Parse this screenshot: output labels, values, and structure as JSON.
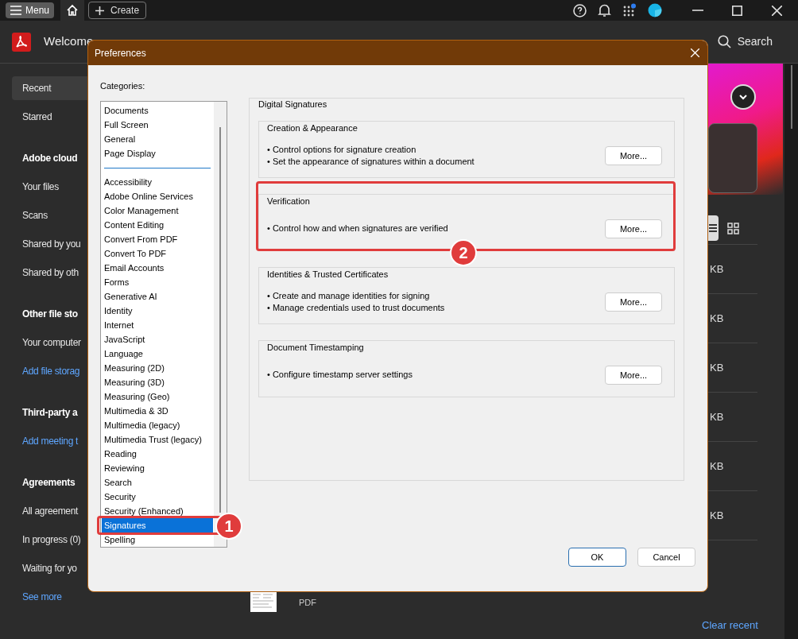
{
  "top_bar": {
    "menu_label": "Menu",
    "create_label": "Create"
  },
  "header": {
    "title": "Welcome",
    "search_label": "Search"
  },
  "sidebar": [
    {
      "kind": "item",
      "label": "Recent",
      "selected": true
    },
    {
      "kind": "item",
      "label": "Starred",
      "selected": false
    },
    {
      "kind": "heading",
      "label": "Adobe cloud"
    },
    {
      "kind": "item",
      "label": "Your files",
      "selected": false
    },
    {
      "kind": "item",
      "label": "Scans",
      "selected": false
    },
    {
      "kind": "item",
      "label": "Shared by you",
      "selected": false
    },
    {
      "kind": "item",
      "label": "Shared by oth",
      "selected": false
    },
    {
      "kind": "heading",
      "label": "Other file sto"
    },
    {
      "kind": "item",
      "label": "Your computer",
      "selected": false
    },
    {
      "kind": "link",
      "label": "Add file storag"
    },
    {
      "kind": "heading",
      "label": "Third-party a"
    },
    {
      "kind": "link",
      "label": "Add meeting t"
    },
    {
      "kind": "heading",
      "label": "Agreements"
    },
    {
      "kind": "item",
      "label": "All agreement",
      "selected": false
    },
    {
      "kind": "item",
      "label": "In progress (0)",
      "selected": false
    },
    {
      "kind": "item",
      "label": "Waiting for yo",
      "selected": false
    },
    {
      "kind": "link",
      "label": "See more"
    }
  ],
  "files": {
    "sizes": [
      "KB",
      "KB",
      "KB",
      "KB",
      "KB",
      "KB"
    ],
    "last_file_type": "PDF",
    "clear_recent": "Clear recent"
  },
  "dialog": {
    "title": "Preferences",
    "categories_label": "Categories:",
    "category_groups": [
      [
        {
          "label": "Documents",
          "selected": false
        },
        {
          "label": "Full Screen",
          "selected": false
        },
        {
          "label": "General",
          "selected": false
        },
        {
          "label": "Page Display",
          "selected": false
        }
      ],
      [
        {
          "label": "Accessibility",
          "selected": false
        },
        {
          "label": "Adobe Online Services",
          "selected": false
        },
        {
          "label": "Color Management",
          "selected": false
        },
        {
          "label": "Content Editing",
          "selected": false
        },
        {
          "label": "Convert From PDF",
          "selected": false
        },
        {
          "label": "Convert To PDF",
          "selected": false
        },
        {
          "label": "Email Accounts",
          "selected": false
        },
        {
          "label": "Forms",
          "selected": false
        },
        {
          "label": "Generative AI",
          "selected": false
        },
        {
          "label": "Identity",
          "selected": false
        },
        {
          "label": "Internet",
          "selected": false
        },
        {
          "label": "JavaScript",
          "selected": false
        },
        {
          "label": "Language",
          "selected": false
        },
        {
          "label": "Measuring (2D)",
          "selected": false
        },
        {
          "label": "Measuring (3D)",
          "selected": false
        },
        {
          "label": "Measuring (Geo)",
          "selected": false
        },
        {
          "label": "Multimedia & 3D",
          "selected": false
        },
        {
          "label": "Multimedia (legacy)",
          "selected": false
        },
        {
          "label": "Multimedia Trust (legacy)",
          "selected": false
        },
        {
          "label": "Reading",
          "selected": false
        },
        {
          "label": "Reviewing",
          "selected": false
        },
        {
          "label": "Search",
          "selected": false
        },
        {
          "label": "Security",
          "selected": false
        },
        {
          "label": "Security (Enhanced)",
          "selected": false
        },
        {
          "label": "Signatures",
          "selected": true
        },
        {
          "label": "Spelling",
          "selected": false
        }
      ]
    ],
    "panel_title": "Digital Signatures",
    "sections": [
      {
        "title": "Creation & Appearance",
        "lines": [
          "• Control options for signature creation",
          "• Set the appearance of signatures within a document"
        ],
        "button": "More..."
      },
      {
        "title": "Verification",
        "lines": [
          "• Control how and when signatures are verified"
        ],
        "button": "More..."
      },
      {
        "title": "Identities & Trusted Certificates",
        "lines": [
          "• Create and manage identities for signing",
          "• Manage credentials used to trust documents"
        ],
        "button": "More..."
      },
      {
        "title": "Document Timestamping",
        "lines": [
          "• Configure timestamp server settings"
        ],
        "button": "More..."
      }
    ],
    "buttons": [
      {
        "label": "OK",
        "default": true
      },
      {
        "label": "Cancel",
        "default": false
      }
    ]
  },
  "annotations": [
    {
      "number": "1"
    },
    {
      "number": "2"
    }
  ]
}
